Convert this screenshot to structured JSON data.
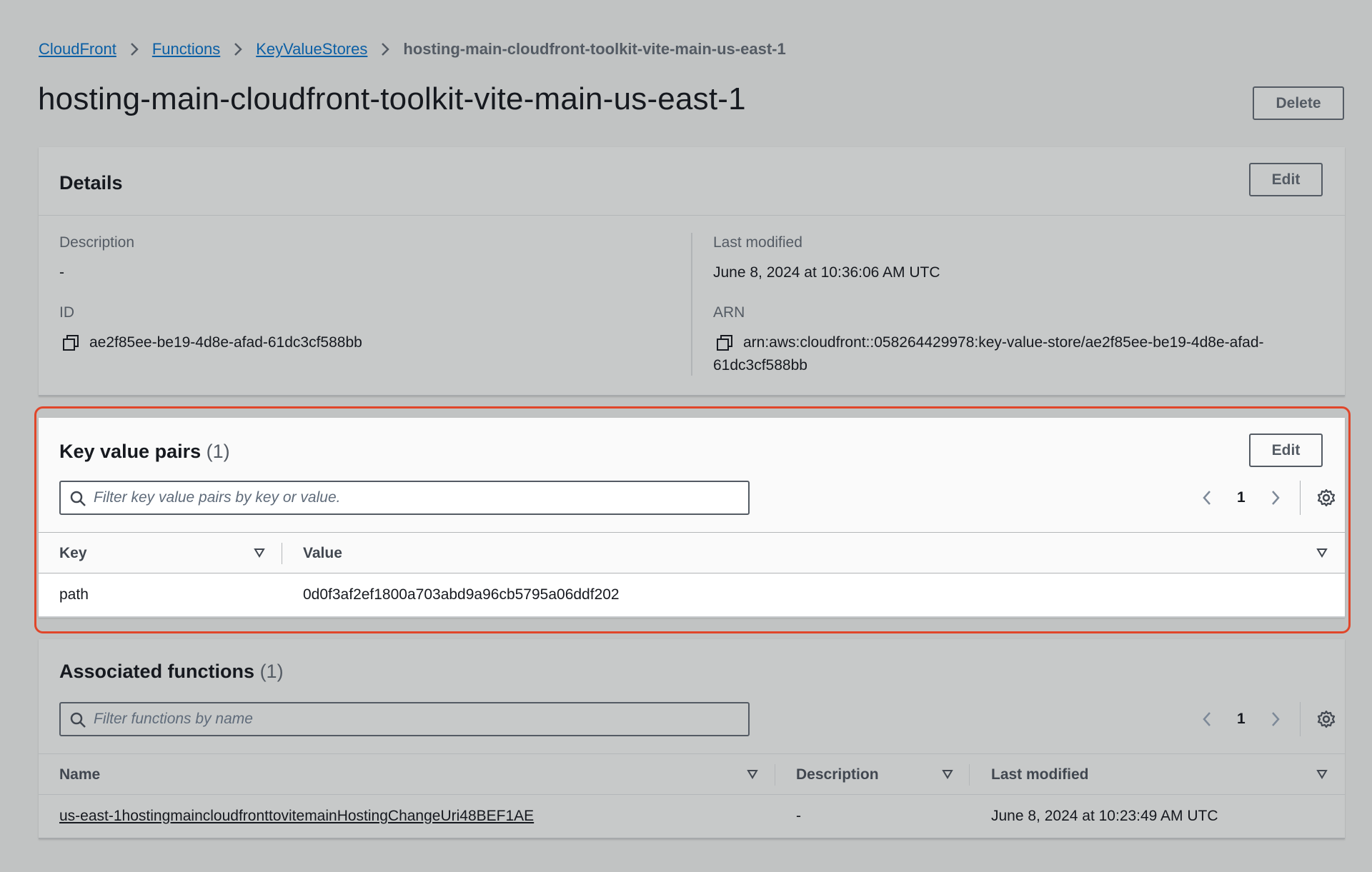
{
  "breadcrumb": {
    "items": [
      "CloudFront",
      "Functions",
      "KeyValueStores"
    ],
    "current": "hosting-main-cloudfront-toolkit-vite-main-us-east-1"
  },
  "page": {
    "title": "hosting-main-cloudfront-toolkit-vite-main-us-east-1",
    "delete_label": "Delete"
  },
  "details": {
    "title": "Details",
    "edit_label": "Edit",
    "description_label": "Description",
    "description_value": "-",
    "id_label": "ID",
    "id_value": "ae2f85ee-be19-4d8e-afad-61dc3cf588bb",
    "last_modified_label": "Last modified",
    "last_modified_value": "June 8, 2024 at 10:36:06 AM UTC",
    "arn_label": "ARN",
    "arn_value_line1": "arn:aws:cloudfront::058264429978:key-value-store/ae2f85ee-be19-4d8e-afad-",
    "arn_value_line2": "61dc3cf588bb"
  },
  "kv_pairs": {
    "title": "Key value pairs",
    "count": "(1)",
    "edit_label": "Edit",
    "search_placeholder": "Filter key value pairs by key or value.",
    "page": "1",
    "columns": [
      "Key",
      "Value"
    ],
    "rows": [
      {
        "key": "path",
        "value": "0d0f3af2ef1800a703abd9a96cb5795a06ddf202"
      }
    ]
  },
  "functions": {
    "title": "Associated functions",
    "count": "(1)",
    "search_placeholder": "Filter functions by name",
    "page": "1",
    "columns": [
      "Name",
      "Description",
      "Last modified"
    ],
    "rows": [
      {
        "name": "us-east-1hostingmaincloudfronttovitemainHostingChangeUri48BEF1AE",
        "description": "-",
        "last_modified": "June 8, 2024 at 10:23:49 AM UTC"
      }
    ]
  },
  "colors": {
    "highlight": "#e0462a",
    "link": "#0b5fa5",
    "background": "#c1c3c3"
  },
  "icons": [
    "chevron-right-icon",
    "copy-icon",
    "search-icon",
    "chevron-left-icon",
    "settings-gear-icon",
    "sort-caret-icon"
  ]
}
